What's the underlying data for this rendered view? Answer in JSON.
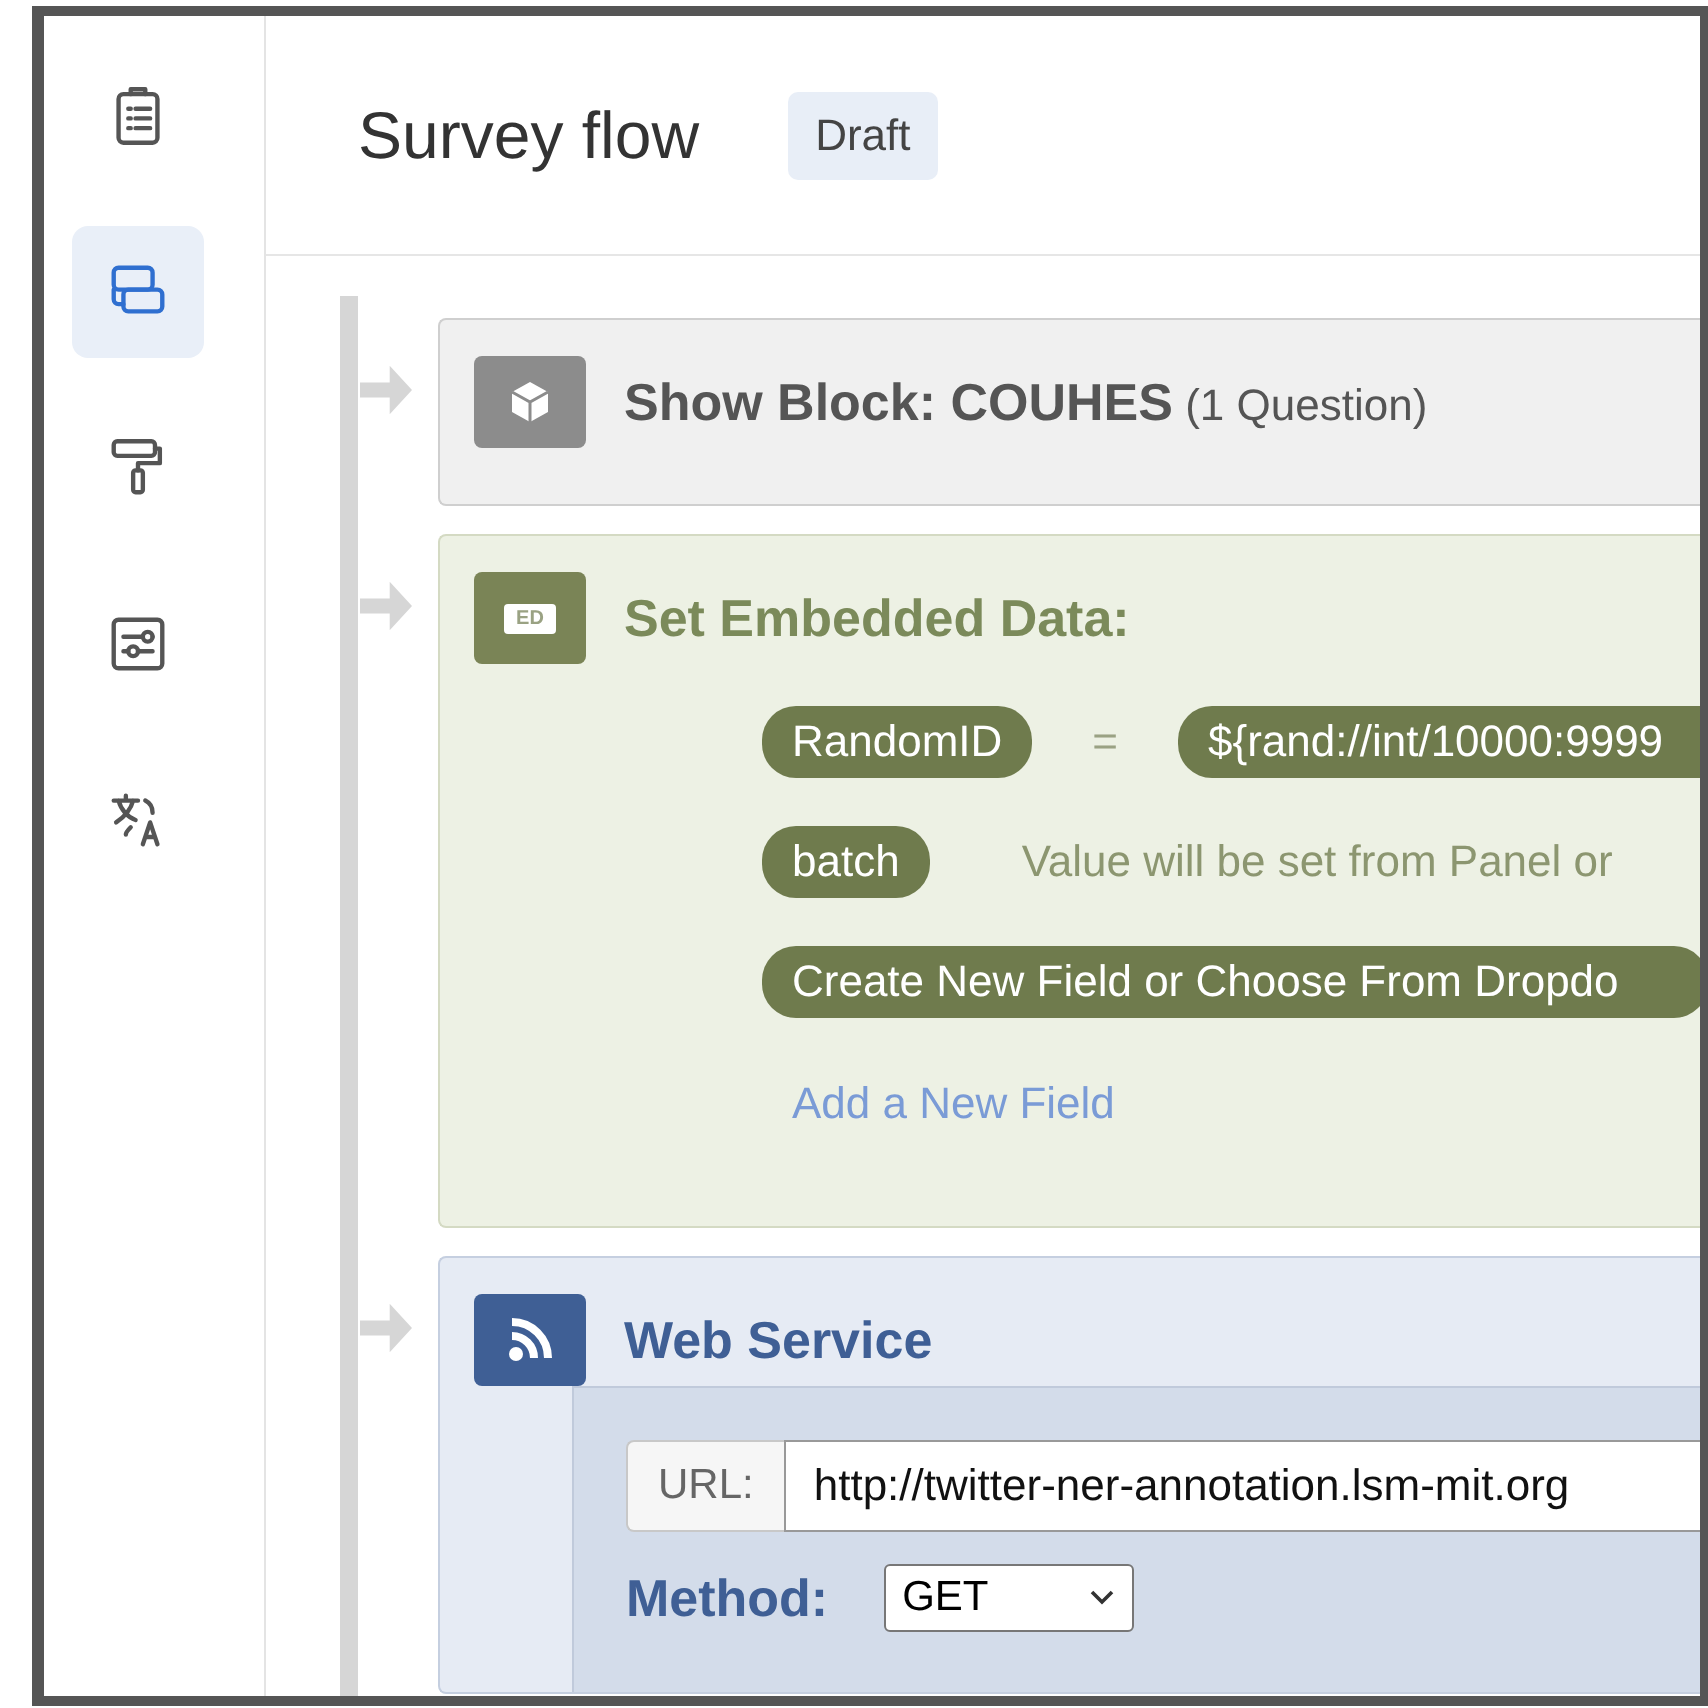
{
  "sidebar": {
    "items": [
      {
        "selected": false
      },
      {
        "selected": true
      },
      {
        "selected": false
      },
      {
        "selected": false
      },
      {
        "selected": false
      }
    ]
  },
  "header": {
    "title": "Survey flow",
    "status": "Draft"
  },
  "flow": [
    {
      "kind": "block",
      "title": "**Show Block: COUHES** (1 Question)"
    },
    {
      "kind": "embedded_data",
      "badge": "ED",
      "title": "Set Embedded Data:",
      "fields": [
        {
          "kind": "value",
          "name": "RandomID",
          "operator": "=",
          "value": "${rand://int/10000:9999"
        },
        {
          "kind": "panel",
          "name": "batch",
          "note": "Value will be set from Panel or"
        }
      ],
      "new_field_placeholder": "Create New Field or Choose From Dropdo",
      "link": "Add a New Field"
    },
    {
      "kind": "web_service",
      "title": "Web Service",
      "url_label": "URL:",
      "url": "http://twitter-ner-annotation.lsm-mit.org",
      "method_label": "Method:",
      "method": "GET"
    }
  ]
}
